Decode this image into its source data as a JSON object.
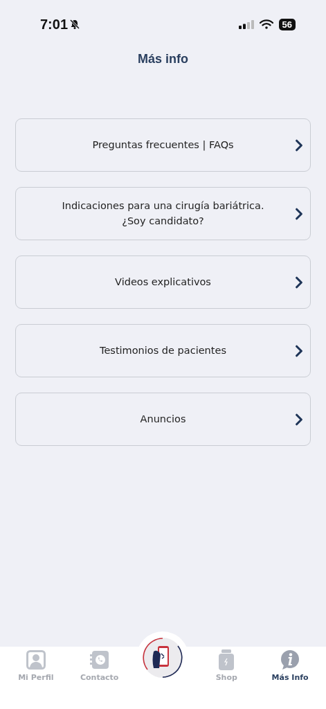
{
  "status_bar": {
    "time": "7:01",
    "silent": true,
    "battery": "56"
  },
  "header": {
    "title": "Más info"
  },
  "menu_items": [
    {
      "label": "Preguntas frecuentes | FAQs"
    },
    {
      "label": "Indicaciones para una cirugía bariátrica.\n¿Soy candidato?"
    },
    {
      "label": "Videos explicativos"
    },
    {
      "label": "Testimonios de pacientes"
    },
    {
      "label": "Anuncios"
    }
  ],
  "tab_bar": [
    {
      "kind": "profile",
      "label": "Mi Perfil",
      "selected": false
    },
    {
      "kind": "contact",
      "label": "Contacto",
      "selected": false
    },
    {
      "kind": "logo",
      "selected": false
    },
    {
      "kind": "shop",
      "label": "Shop",
      "selected": false
    },
    {
      "kind": "info",
      "label": "Más Info",
      "selected": true
    }
  ]
}
